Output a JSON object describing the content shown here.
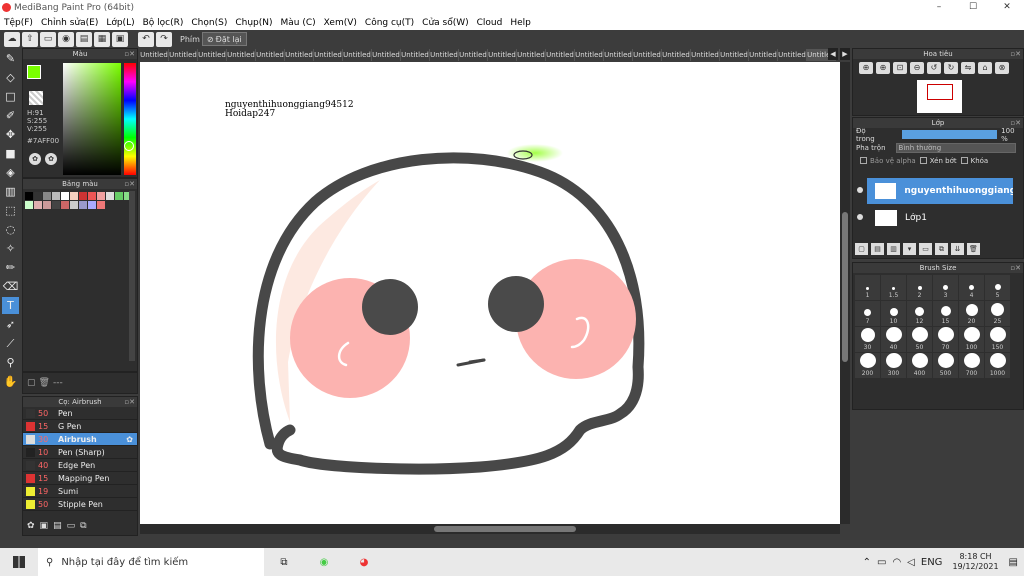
{
  "window": {
    "title": "MediBang Paint Pro (64bit)",
    "min": "–",
    "max": "☐",
    "close": "✕"
  },
  "menu": [
    "Tệp(F)",
    "Chỉnh sửa(E)",
    "Lớp(L)",
    "Bộ lọc(R)",
    "Chọn(S)",
    "Chụp(N)",
    "Màu (C)",
    "Xem(V)",
    "Công cụ(T)",
    "Cửa sổ(W)",
    "Cloud",
    "Help"
  ],
  "toolbar": {
    "shortcut_label": "Phím",
    "reset_label": "Đặt lại"
  },
  "color_panel": {
    "title": "Màu",
    "h": "H:91",
    "s": "S:255",
    "v": "V:255",
    "hex": "#7AFF00",
    "fg_color": "#7AFF00"
  },
  "palette_panel": {
    "title": "Bảng màu",
    "colors": [
      "#000",
      "#333",
      "#888",
      "#bbb",
      "#fff",
      "#f5d0c0",
      "#c33",
      "#e55",
      "#f0a0a0",
      "#ddd",
      "#6c6",
      "#8d8",
      "#cfc",
      "#e0b0b0",
      "#c99",
      "#444",
      "#c66",
      "#ccc",
      "#99c",
      "#aaf",
      "#e77"
    ]
  },
  "layer_footer": {
    "label": "---"
  },
  "brush_panel": {
    "title": "Cọ: Airbrush",
    "items": [
      {
        "size": "50",
        "name": "Pen",
        "color": "#333"
      },
      {
        "size": "15",
        "name": "G Pen",
        "color": "#d33"
      },
      {
        "size": "30",
        "name": "Airbrush",
        "color": "#ddd",
        "selected": true
      },
      {
        "size": "10",
        "name": "Pen (Sharp)",
        "color": "#222"
      },
      {
        "size": "40",
        "name": "Edge Pen",
        "color": "#333"
      },
      {
        "size": "15",
        "name": "Mapping Pen",
        "color": "#d33"
      },
      {
        "size": "19",
        "name": "Sumi",
        "color": "#ee3"
      },
      {
        "size": "50",
        "name": "Stipple Pen",
        "color": "#ee3"
      }
    ]
  },
  "tabs": [
    "Untitled",
    "Untitled",
    "Untitled",
    "Untitled",
    "Untitled",
    "Untitled",
    "Untitled",
    "Untitled",
    "Untitled",
    "Untitled",
    "Untitled",
    "Untitled",
    "Untitled",
    "Untitled",
    "Untitled",
    "Untitled",
    "Untitled",
    "Untitled",
    "Untitled",
    "Untitled",
    "Untitled",
    "Untitled",
    "Untitled",
    "Untitled"
  ],
  "canvas": {
    "watermark_line1": "nguyenthihuonggiang94512",
    "watermark_line2": "Hoidap247"
  },
  "navigator": {
    "title": "Hoa tiêu"
  },
  "layers": {
    "title": "Lớp",
    "opacity_label": "Độ trong",
    "opacity_value": "100 %",
    "blend_label": "Pha trộn",
    "blend_value": "Bình thường",
    "protect_alpha": "Bảo vệ alpha",
    "clip": "Xén bớt",
    "lock": "Khóa",
    "items": [
      {
        "name": "nguyenthihuonggiang",
        "selected": true
      },
      {
        "name": "Lớp1",
        "selected": false
      }
    ]
  },
  "brush_size": {
    "title": "Brush Size",
    "sizes": [
      "1",
      "1.5",
      "2",
      "3",
      "4",
      "5",
      "7",
      "10",
      "12",
      "15",
      "20",
      "25",
      "30",
      "40",
      "50",
      "70",
      "100",
      "150",
      "200",
      "300",
      "400",
      "500",
      "700",
      "1000"
    ]
  },
  "taskbar": {
    "search_placeholder": "Nhập tại đây để tìm kiếm",
    "lang": "ENG",
    "time": "8:18 CH",
    "date": "19/12/2021"
  }
}
